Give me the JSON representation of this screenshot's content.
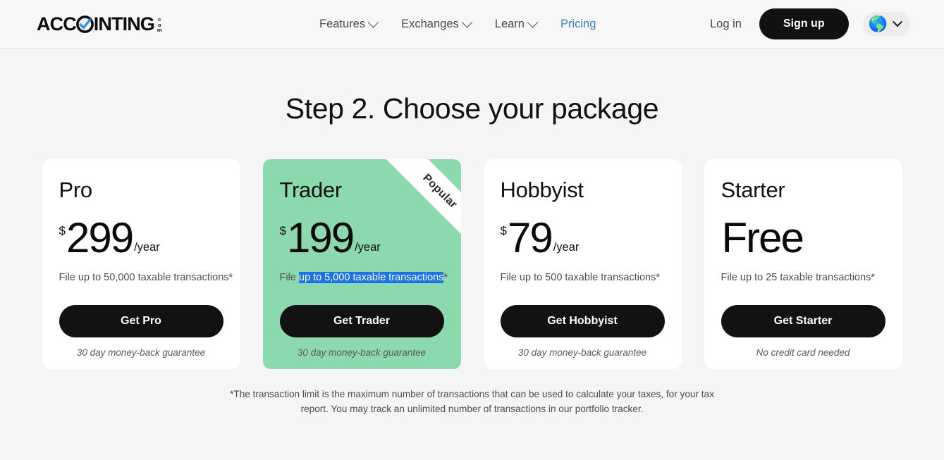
{
  "header": {
    "logo": {
      "word_before": "ACC",
      "mark": "o-check-mark",
      "word_after": "INTING",
      "dotcom_top": "c",
      "dotcom_mid": "o",
      "dotcom_bottom": "m",
      "dotcom": ".com"
    },
    "nav": [
      {
        "label": "Features",
        "has_caret": true,
        "active": false
      },
      {
        "label": "Exchanges",
        "has_caret": true,
        "active": false
      },
      {
        "label": "Learn",
        "has_caret": true,
        "active": false
      },
      {
        "label": "Pricing",
        "has_caret": false,
        "active": true
      }
    ],
    "login_label": "Log in",
    "signup_label": "Sign up",
    "language": {
      "icon": "globe-icon",
      "glyph": "🌎"
    },
    "accent_link_color": "#3b82c4"
  },
  "main": {
    "title": "Step 2. Choose your package",
    "footnote": "*The transaction limit is the maximum number of transactions that can be used to calculate your taxes, for your tax report. You may track an unlimited number of transactions in our portfolio tracker.",
    "featured_color": "#8cd9ae",
    "selection_color": "#1a73e8",
    "cards": [
      {
        "name": "Pro",
        "currency": "$",
        "amount": "299",
        "period": "/year",
        "limit_prefix": "File ",
        "limit_selected": "",
        "limit_rest": "up to 50,000 taxable transactions*",
        "cta": "Get Pro",
        "note": "30 day money-back guarantee",
        "featured": false,
        "ribbon": ""
      },
      {
        "name": "Trader",
        "currency": "$",
        "amount": "199",
        "period": "/year",
        "limit_prefix": "File ",
        "limit_selected": "up to 5,000 taxable transactions",
        "limit_rest": "*",
        "cta": "Get Trader",
        "note": "30 day money-back guarantee",
        "featured": true,
        "ribbon": "Popular"
      },
      {
        "name": "Hobbyist",
        "currency": "$",
        "amount": "79",
        "period": "/year",
        "limit_prefix": "File ",
        "limit_selected": "",
        "limit_rest": "up to 500 taxable transactions*",
        "cta": "Get Hobbyist",
        "note": "30 day money-back guarantee",
        "featured": false,
        "ribbon": ""
      },
      {
        "name": "Starter",
        "currency": "",
        "amount": "Free",
        "period": "",
        "limit_prefix": "File ",
        "limit_selected": "",
        "limit_rest": "up to 25 taxable transactions*",
        "cta": "Get Starter",
        "note": "No credit card needed",
        "featured": false,
        "ribbon": ""
      }
    ]
  }
}
